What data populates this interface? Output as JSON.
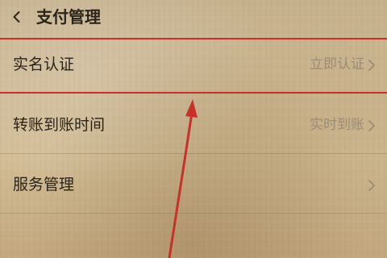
{
  "header": {
    "title": "支付管理"
  },
  "rows": [
    {
      "label": "实名认证",
      "value": "立即认证"
    },
    {
      "label": "转账到账时间",
      "value": "实时到账"
    },
    {
      "label": "服务管理",
      "value": ""
    }
  ],
  "icons": {
    "back": "chevron-left-icon",
    "chevron": "chevron-right-icon",
    "arrow": "red-arrow-icon"
  },
  "colors": {
    "highlight": "#c9302a",
    "text": "#2a241b",
    "secondary_text": "#9b8c74"
  }
}
